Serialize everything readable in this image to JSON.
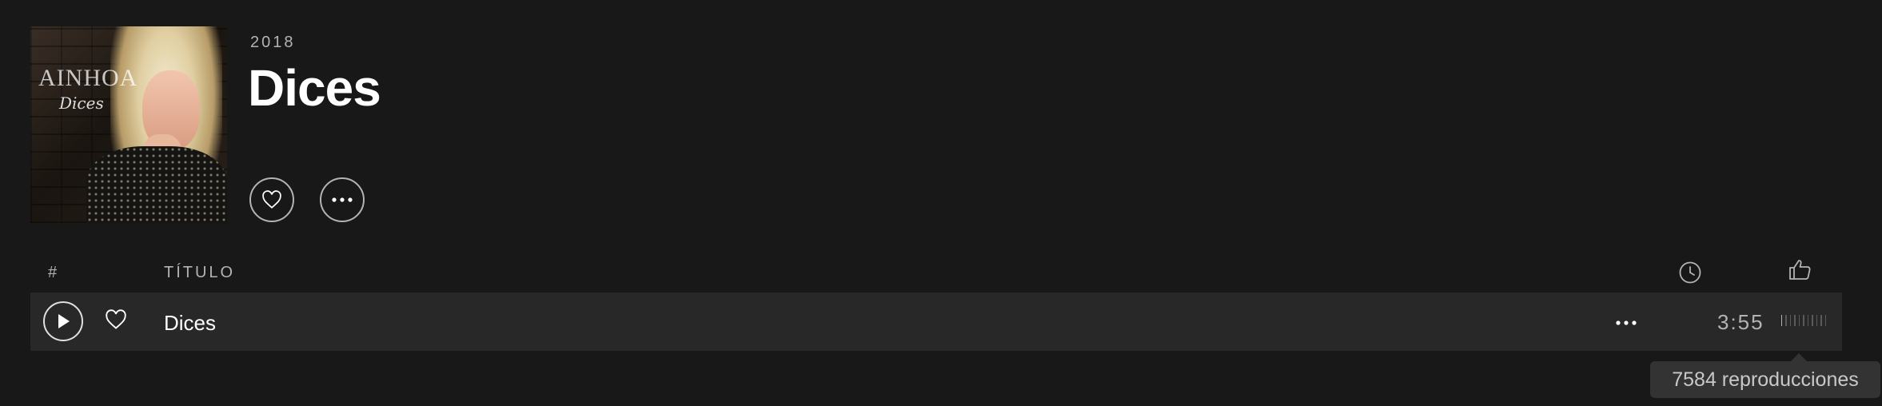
{
  "album": {
    "year": "2018",
    "title": "Dices",
    "cover": {
      "artist_text": "AINHOA",
      "title_text": "Dices"
    }
  },
  "actions": {
    "like_icon": "heart-outline-icon",
    "more_icon": "ellipsis-icon"
  },
  "tracklist": {
    "headers": {
      "number": "#",
      "title": "TÍTULO",
      "duration_icon": "clock-icon",
      "popularity_icon": "thumbs-up-icon"
    },
    "tracks": [
      {
        "name": "Dices",
        "duration": "3:55",
        "popularity_bars_lit": 1,
        "popularity_bars_total": 11
      }
    ]
  },
  "tooltip": {
    "text": "7584 reproducciones"
  },
  "colors": {
    "background": "#181818",
    "row_highlight": "#282828",
    "secondary_text": "#b3b3b3",
    "primary_text": "#ffffff"
  }
}
